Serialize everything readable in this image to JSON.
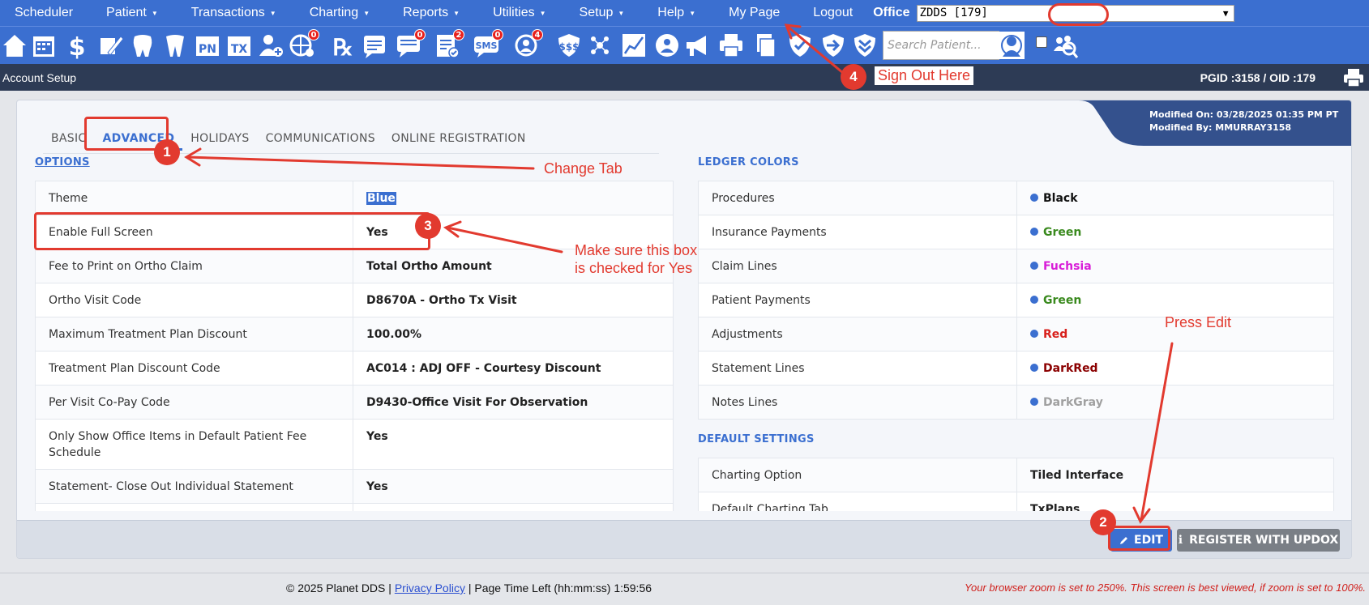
{
  "menu": {
    "items": [
      {
        "label": "Scheduler",
        "caret": false
      },
      {
        "label": "Patient",
        "caret": true
      },
      {
        "label": "Transactions",
        "caret": true
      },
      {
        "label": "Charting",
        "caret": true
      },
      {
        "label": "Reports",
        "caret": true
      },
      {
        "label": "Utilities",
        "caret": true
      },
      {
        "label": "Setup",
        "caret": true
      },
      {
        "label": "Help",
        "caret": true
      },
      {
        "label": "My Page",
        "caret": false
      },
      {
        "label": "Logout",
        "caret": false
      }
    ],
    "office_label": "Office",
    "office_value": "ZDDS [179]"
  },
  "toolbar": {
    "icons": [
      "home-icon",
      "calendar-icon",
      "dollar-icon",
      "pen-icon",
      "tooth-icon",
      "teeth-icon",
      "pn-icon",
      "tx-icon",
      "add-user-icon",
      "globe-icon",
      "rx-icon",
      "note-icon",
      "chat-icon",
      "checklist-icon",
      "sms-icon",
      "recall-icon",
      "dollars-icon",
      "network-icon",
      "chart-icon",
      "world-icon",
      "megaphone-icon",
      "printer-icon",
      "documents-icon",
      "shield-icon",
      "arrow-icon",
      "double-chevron-icon"
    ],
    "badges": {
      "globe-icon": "0",
      "chat-icon": "0",
      "checklist-icon": "2",
      "sms-icon": "0",
      "recall-icon": "4"
    },
    "search_placeholder": "Search Patient..."
  },
  "header": {
    "title": "Account Setup",
    "pgid": "PGID :3158  /  OID :179"
  },
  "modified": {
    "on": "Modified On: 03/28/2025 01:35 PM PT",
    "by": "Modified By: MMURRAY3158"
  },
  "tabs": [
    "BASIC",
    "ADVANCED",
    "HOLIDAYS",
    "COMMUNICATIONS",
    "ONLINE REGISTRATION"
  ],
  "active_tab": "ADVANCED",
  "options": {
    "title": "OPTIONS",
    "rows": [
      {
        "label": "Theme",
        "value": "Blue"
      },
      {
        "label": "Enable Full Screen",
        "value": "Yes"
      },
      {
        "label": "Fee to Print on Ortho Claim",
        "value": "Total Ortho Amount"
      },
      {
        "label": "Ortho Visit Code",
        "value": "D8670A - Ortho Tx Visit"
      },
      {
        "label": "Maximum Treatment Plan Discount",
        "value": "100.00%"
      },
      {
        "label": "Treatment Plan Discount Code",
        "value": "AC014 : ADJ OFF - Courtesy Discount"
      },
      {
        "label": "Per Visit Co-Pay Code",
        "value": "D9430-Office Visit For Observation"
      },
      {
        "label": "Only Show Office Items in Default Patient Fee Schedule",
        "value": "Yes"
      },
      {
        "label": "Statement- Close Out Individual Statement",
        "value": "Yes"
      },
      {
        "label": "",
        "value": ""
      }
    ]
  },
  "ledger": {
    "title": "LEDGER COLORS",
    "rows": [
      {
        "label": "Procedures",
        "value": "Black",
        "color": "#111111"
      },
      {
        "label": "Insurance Payments",
        "value": "Green",
        "color": "#3a8a1e"
      },
      {
        "label": "Claim Lines",
        "value": "Fuchsia",
        "color": "#d81ed8"
      },
      {
        "label": "Patient Payments",
        "value": "Green",
        "color": "#3a8a1e"
      },
      {
        "label": "Adjustments",
        "value": "Red",
        "color": "#d8201c"
      },
      {
        "label": "Statement Lines",
        "value": "DarkRed",
        "color": "#8b0000"
      },
      {
        "label": "Notes Lines",
        "value": "DarkGray",
        "color": "#a0a0a0"
      }
    ]
  },
  "defaults": {
    "title": "DEFAULT SETTINGS",
    "rows": [
      {
        "label": "Charting Option",
        "value": "Tiled Interface"
      },
      {
        "label": "Default Charting Tab",
        "value": "TxPlans"
      }
    ]
  },
  "buttons": {
    "edit": "EDIT",
    "register": "REGISTER WITH UPDOX"
  },
  "footer": {
    "copyright": "© 2025 Planet DDS | ",
    "privacy": "Privacy Policy",
    "timer": " |  Page Time Left (hh:mm:ss) 1:59:56",
    "zoom_warning": "Your browser zoom is set to 250%. This screen is best viewed, if zoom is set to 100%."
  },
  "annotations": {
    "n1": "1",
    "n2": "2",
    "n3": "3",
    "n4": "4",
    "change_tab": "Change Tab",
    "full_screen_line1": "Make sure this box",
    "full_screen_line2": "is checked for Yes",
    "press_edit": "Press Edit",
    "sign_out": "Sign Out Here"
  },
  "colors": {
    "accent": "#3b6fd0",
    "header": "#2d3b55",
    "annotation": "#e23a2f"
  }
}
